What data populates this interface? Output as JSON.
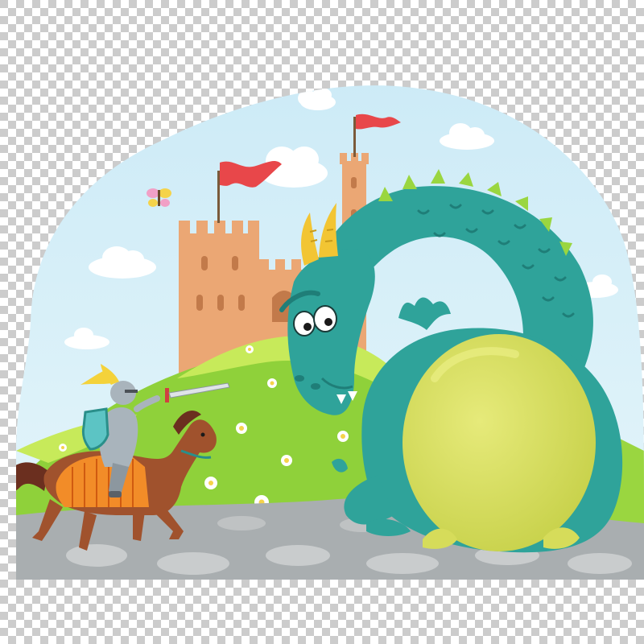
{
  "image": {
    "background": "transparent-checkerboard",
    "subject": "knight-vs-dragon",
    "colors": {
      "checker_light": "#ffffff",
      "checker_dark": "#cccccc",
      "sky_top": "#c9e9f6",
      "sky_bottom": "#e8f7fb",
      "cloud": "#ffffff",
      "castle": "#eba774",
      "castle_shade": "#c27a4a",
      "flag": "#e8474a",
      "hill": "#8fd13a",
      "hill_light": "#c7ea5a",
      "ground": "#a9aeb0",
      "stone": "#c9cccd",
      "dragon": "#2fa39a",
      "dragon_dark": "#1f7e78",
      "dragon_belly": "#d6dc5a",
      "horn": "#f2c533",
      "horse": "#a0522d",
      "horse_mane": "#6b2f1f",
      "caparison": "#f28c28",
      "armor": "#a9b4bc",
      "plume": "#f4d23a",
      "butterfly": "#f1a0c6"
    }
  }
}
